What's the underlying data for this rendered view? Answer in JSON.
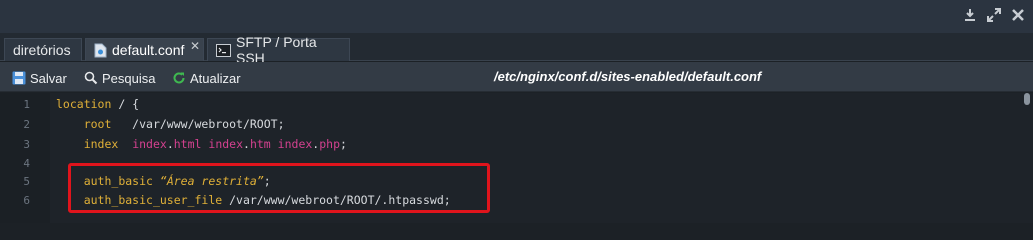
{
  "window": {
    "controls": [
      {
        "icon": "download-icon"
      },
      {
        "icon": "expand-icon"
      },
      {
        "icon": "close-icon"
      }
    ]
  },
  "tabs": [
    {
      "label": "diretórios",
      "icon": ""
    },
    {
      "label": "default.conf",
      "icon": "file-gear-icon",
      "active": true,
      "closable": true
    },
    {
      "label": "SFTP / Porta SSH",
      "icon": "terminal-icon"
    }
  ],
  "toolbar": {
    "save_label": "Salvar",
    "search_label": "Pesquisa",
    "refresh_label": "Atualizar",
    "file_path": "/etc/nginx/conf.d/sites-enabled/default.conf"
  },
  "editor": {
    "line_numbers": [
      "1",
      "2",
      "3",
      "4",
      "5",
      "6"
    ],
    "lines": [
      "location / {",
      "    root   /var/www/webroot/ROOT;",
      "    index  index.html index.htm index.php;",
      "",
      "    auth_basic “Área restrita”;",
      "    auth_basic_user_file /var/www/webroot/ROOT/.htpasswd;"
    ]
  },
  "colors": {
    "keyword": "#e0b038",
    "value": "#d3418f",
    "highlight_border": "#e0141c",
    "background": "#1e2329"
  }
}
